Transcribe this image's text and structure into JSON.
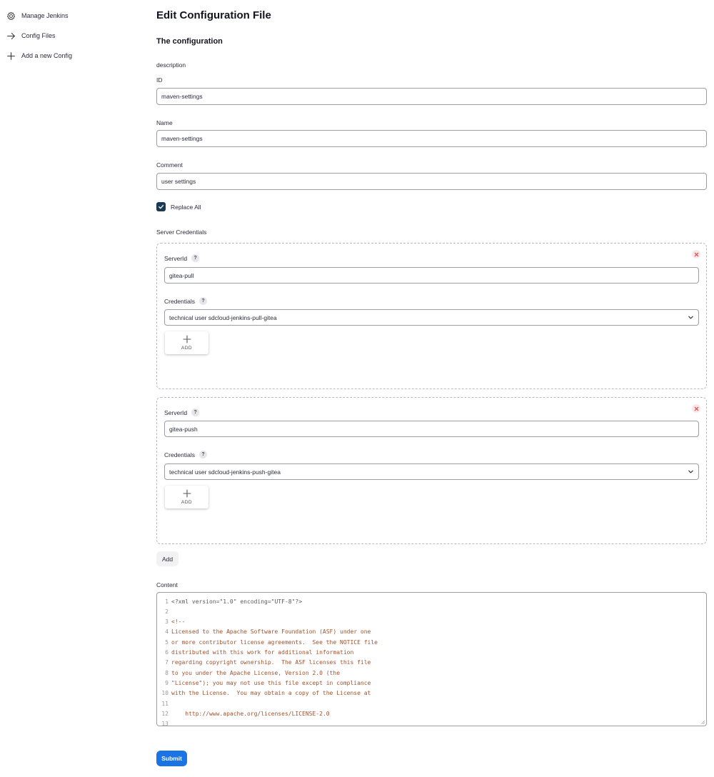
{
  "sidebar": {
    "items": [
      {
        "label": "Manage Jenkins",
        "icon": "gear-icon"
      },
      {
        "label": "Config Files",
        "icon": "arrow-right-icon"
      },
      {
        "label": "Add a new Config",
        "icon": "plus-icon"
      }
    ]
  },
  "main": {
    "title": "Edit Configuration File",
    "section_title": "The configuration",
    "description_label": "description",
    "id_label": "ID",
    "id_value": "maven-settings",
    "name_label": "Name",
    "name_value": "maven-settings",
    "comment_label": "Comment",
    "comment_value": "user settings",
    "replace_all_label": "Replace All",
    "replace_all_checked": true,
    "server_credentials_label": "Server Credentials",
    "servers": [
      {
        "serverid_label": "ServerId",
        "serverid_value": "gitea-pull",
        "credentials_label": "Credentials",
        "credentials_value": "technical user sdcloud-jenkins-pull-gitea",
        "add_label": "ADD"
      },
      {
        "serverid_label": "ServerId",
        "serverid_value": "gitea-push",
        "credentials_label": "Credentials",
        "credentials_value": "technical user sdcloud-jenkins-push-gitea",
        "add_label": "ADD"
      }
    ],
    "help_glyph": "?",
    "add_button_label": "Add",
    "content_label": "Content",
    "content_lines": [
      {
        "n": "1",
        "text": "<?xml version=\"1.0\" encoding=\"UTF-8\"?>"
      },
      {
        "n": "2",
        "text": ""
      },
      {
        "n": "3",
        "text": "<!--"
      },
      {
        "n": "4",
        "text": "Licensed to the Apache Software Foundation (ASF) under one"
      },
      {
        "n": "5",
        "text": "or more contributor license agreements.  See the NOTICE file"
      },
      {
        "n": "6",
        "text": "distributed with this work for additional information"
      },
      {
        "n": "7",
        "text": "regarding copyright ownership.  The ASF licenses this file"
      },
      {
        "n": "8",
        "text": "to you under the Apache License, Version 2.0 (the"
      },
      {
        "n": "9",
        "text": "\"License\"); you may not use this file except in compliance"
      },
      {
        "n": "10",
        "text": "with the License.  You may obtain a copy of the License at"
      },
      {
        "n": "11",
        "text": ""
      },
      {
        "n": "12",
        "text": "    http://www.apache.org/licenses/LICENSE-2.0"
      },
      {
        "n": "13",
        "text": ""
      }
    ],
    "submit_label": "Submit"
  },
  "colors": {
    "accent": "#1b74e4",
    "checkbox": "#1a3954",
    "code_comment": "#a0522d"
  }
}
